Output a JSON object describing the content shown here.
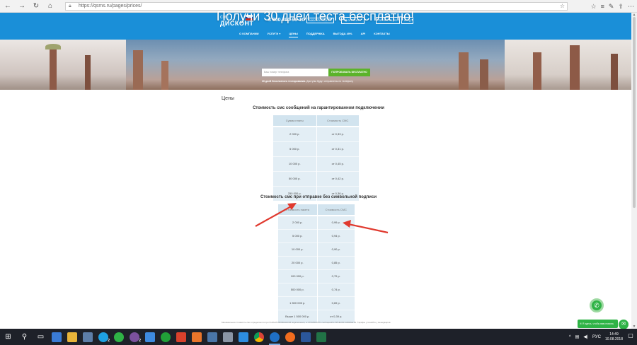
{
  "browser": {
    "url": "https://qsms.ru/pages/prices/",
    "icons": {
      "back": "arrow-left-icon",
      "forward": "arrow-right-icon",
      "reload": "reload-icon",
      "home": "home-icon"
    }
  },
  "header": {
    "logo_top": "СМС",
    "logo_main": "ДИСКОНТ",
    "phone": "8 800 700-99-10",
    "callback": "ЗАКАЗАТЬ ЗВОНОК",
    "pay": "ОПЛАТИТЬ",
    "register": "РЕГИСТРАЦИЯ",
    "login": "ВХОД",
    "nav": [
      "О КОМПАНИИ",
      "УСЛУГИ ▾",
      "ЦЕНЫ",
      "ПОДДЕРЖКА",
      "ВЫГОДА 49%",
      "API",
      "КОНТАКТЫ"
    ],
    "colors": {
      "bar": "#1a8fd8"
    }
  },
  "hero": {
    "title": "Получи 30 дней теста бесплатно!",
    "phone_placeholder": "Ваш номер телефона",
    "button": "ПОПРОБОВАТЬ БЕСПЛАТНО",
    "note_bold": "30 дней бесплатного тестирования.",
    "note_rest": " Доступы будут отправлены по телефону",
    "colors": {
      "button": "#5bb32a"
    }
  },
  "page": {
    "title": "Цены",
    "table1": {
      "title": "Стоимость смс сообщений на гарантированном подключении",
      "headers": [
        "Сумма платы",
        "Стоимость СМС"
      ],
      "rows": [
        [
          "2 000 р.",
          "от 0,33 р."
        ],
        [
          "5 000 р.",
          "от 0,31 р."
        ],
        [
          "10 000 р.",
          "от 0,45 р."
        ],
        [
          "50 000 р.",
          "от 0,42 р."
        ],
        [
          "250 000 р.",
          "от 0,36 р."
        ]
      ]
    },
    "table2": {
      "title": "Стоимость смс при отправке без символьной подписи",
      "headers": [
        "Стоимость пакета",
        "Стоимость СМС"
      ],
      "rows": [
        [
          "2 000 р.",
          "0,99 р."
        ],
        [
          "5 000 р.",
          "0,94 р."
        ],
        [
          "10 000 р.",
          "0,90 р."
        ],
        [
          "20 000 р.",
          "0,85 р."
        ],
        [
          "100 000 р.",
          "0,79 р."
        ],
        [
          "500 000 р.",
          "0,74 р."
        ],
        [
          "1 500 000 р.",
          "0,69 р."
        ],
        [
          "Выше 1 500 000 р.",
          "от 0,39 р."
        ]
      ]
    },
    "footer": "Минимальная стоимость смс определяется при ГАРАНТИРОВАННОМ подключении, а СТОИМОСТЬ сообщений в ЛИЧНОМ КАБИНЕТЕ. Тарифы уточняйте у менеджеров."
  },
  "widgets": {
    "chat_text": "Я здесь, чтобы вам помочь",
    "colors": {
      "green": "#2fb346"
    }
  },
  "taskbar": {
    "lang": "РУС",
    "time": "14:49",
    "date": "10.08.2018",
    "badge1": "2",
    "badge2": "2"
  }
}
